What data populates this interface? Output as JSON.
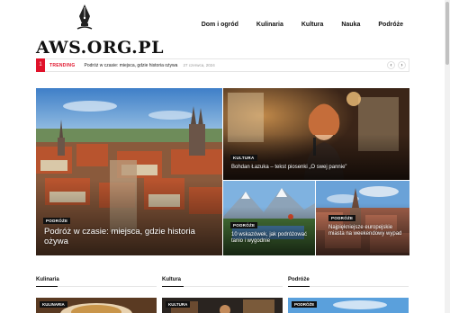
{
  "brand": {
    "logo_text": "AWS.ORG.PL"
  },
  "nav": {
    "items": [
      {
        "label": "Dom i ogród"
      },
      {
        "label": "Kulinaria"
      },
      {
        "label": "Kultura"
      },
      {
        "label": "Nauka"
      },
      {
        "label": "Podróże"
      }
    ]
  },
  "trending": {
    "number": "1",
    "tag": "TRENDING",
    "headline": "Podróż w czasie: miejsca, gdzie historia ożywa",
    "date": "27 czerwca, 2024",
    "prev_icon": "chevron-left-icon",
    "next_icon": "chevron-right-icon"
  },
  "featured": [
    {
      "category": "PODRÓŻE",
      "title": "Podróż w czasie: miejsca, gdzie historia ożywa"
    },
    {
      "category": "KULTURA",
      "title": "Bohdan Łazuka – tekst piosenki „O swej pannie”"
    },
    {
      "category": "PODRÓŻE",
      "title": "10 wskazówek, jak podróżować tanio i wygodnie"
    },
    {
      "category": "PODRÓŻE",
      "title": "Najpiękniejsze europejskie miasta na weekendowy wypad"
    }
  ],
  "sections": [
    {
      "label": "Kulinaria",
      "badge": "KULINARIA"
    },
    {
      "label": "Kultura",
      "badge": "KULTURA"
    },
    {
      "label": "Podróże",
      "badge": "PODRÓŻE"
    }
  ],
  "colors": {
    "accent": "#e0122a",
    "badge_bg": "#111111"
  }
}
